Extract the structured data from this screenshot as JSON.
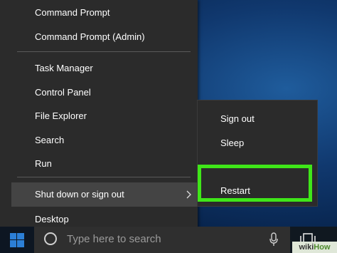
{
  "winx_menu": {
    "items": [
      {
        "label": "Command Prompt"
      },
      {
        "label": "Command Prompt (Admin)"
      },
      {
        "label": "Task Manager"
      },
      {
        "label": "Control Panel"
      },
      {
        "label": "File Explorer"
      },
      {
        "label": "Search"
      },
      {
        "label": "Run"
      },
      {
        "label": "Shut down or sign out",
        "has_submenu": true,
        "hovered": true
      },
      {
        "label": "Desktop"
      }
    ]
  },
  "submenu": {
    "items": [
      {
        "label": "Sign out"
      },
      {
        "label": "Sleep"
      },
      {
        "label": "Restart",
        "highlighted": true
      }
    ]
  },
  "taskbar": {
    "search_placeholder": "Type here to search"
  },
  "watermark": {
    "wiki": "wiki",
    "how": "How"
  },
  "colors": {
    "menu_bg": "#2b2b2b",
    "highlight": "#3fe619",
    "desktop": "#10386e"
  }
}
